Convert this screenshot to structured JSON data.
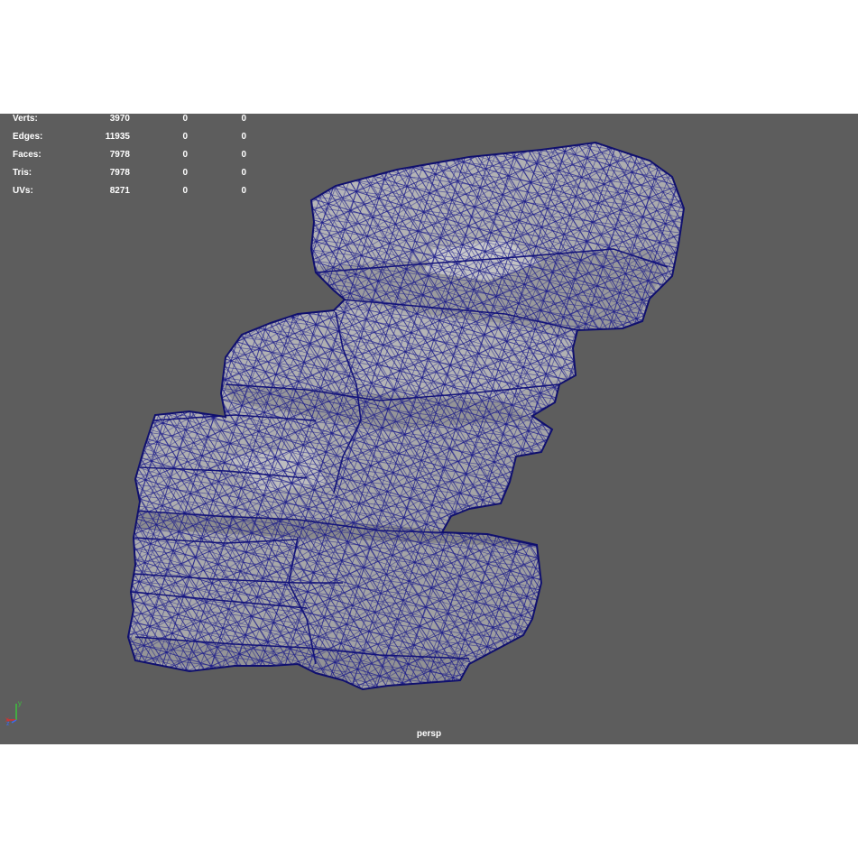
{
  "viewport": {
    "camera_name": "persp",
    "background_color": "#5d5d5d",
    "wire_color": "#1a1a8c",
    "shade_color": "#a9a9ab"
  },
  "hud_stats": [
    {
      "label": "Verts:",
      "v1": "3970",
      "v2": "0",
      "v3": "0"
    },
    {
      "label": "Edges:",
      "v1": "11935",
      "v2": "0",
      "v3": "0"
    },
    {
      "label": "Faces:",
      "v1": "7978",
      "v2": "0",
      "v3": "0"
    },
    {
      "label": "Tris:",
      "v1": "7978",
      "v2": "0",
      "v3": "0"
    },
    {
      "label": "UVs:",
      "v1": "8271",
      "v2": "0",
      "v3": "0"
    }
  ],
  "axis_gizmo": {
    "labels": [
      "x",
      "y",
      "z"
    ],
    "icon": "axis-gizmo-icon"
  },
  "mesh": {
    "icon": "rock-mesh-wireframe"
  }
}
